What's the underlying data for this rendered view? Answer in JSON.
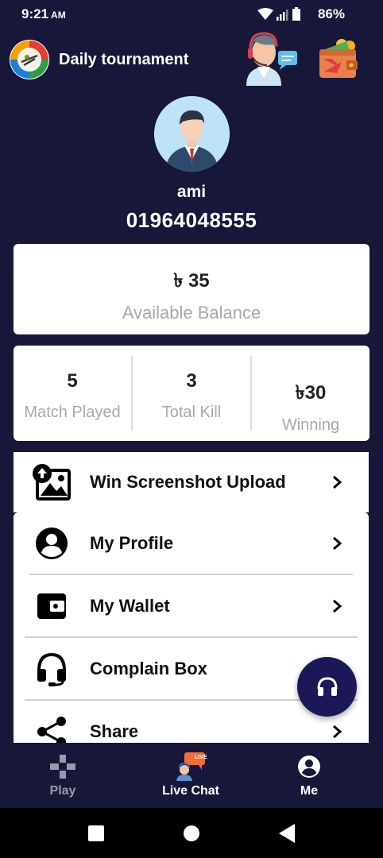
{
  "status_bar": {
    "time": "9:21",
    "ampm": "AM",
    "battery": "86%"
  },
  "header": {
    "title": "Daily tournament"
  },
  "profile": {
    "name": "ami",
    "phone": "01964048555"
  },
  "balance": {
    "amount": "৳ 35",
    "label": "Available Balance"
  },
  "stats": [
    {
      "value": "5",
      "label": "Match Played"
    },
    {
      "value": "3",
      "label": "Total Kill"
    },
    {
      "value": "৳30",
      "label": "Winning"
    }
  ],
  "menu": {
    "upload": "Win Screenshot Upload",
    "profile": "My Profile",
    "wallet": "My Wallet",
    "complain": "Complain Box",
    "share": "Share"
  },
  "bottom_nav": {
    "play": "Play",
    "live_chat": "Live Chat",
    "live_badge": "LIVE",
    "me": "Me"
  },
  "colors": {
    "background": "#17173a",
    "fab": "#1b1858",
    "card": "#ffffff"
  }
}
